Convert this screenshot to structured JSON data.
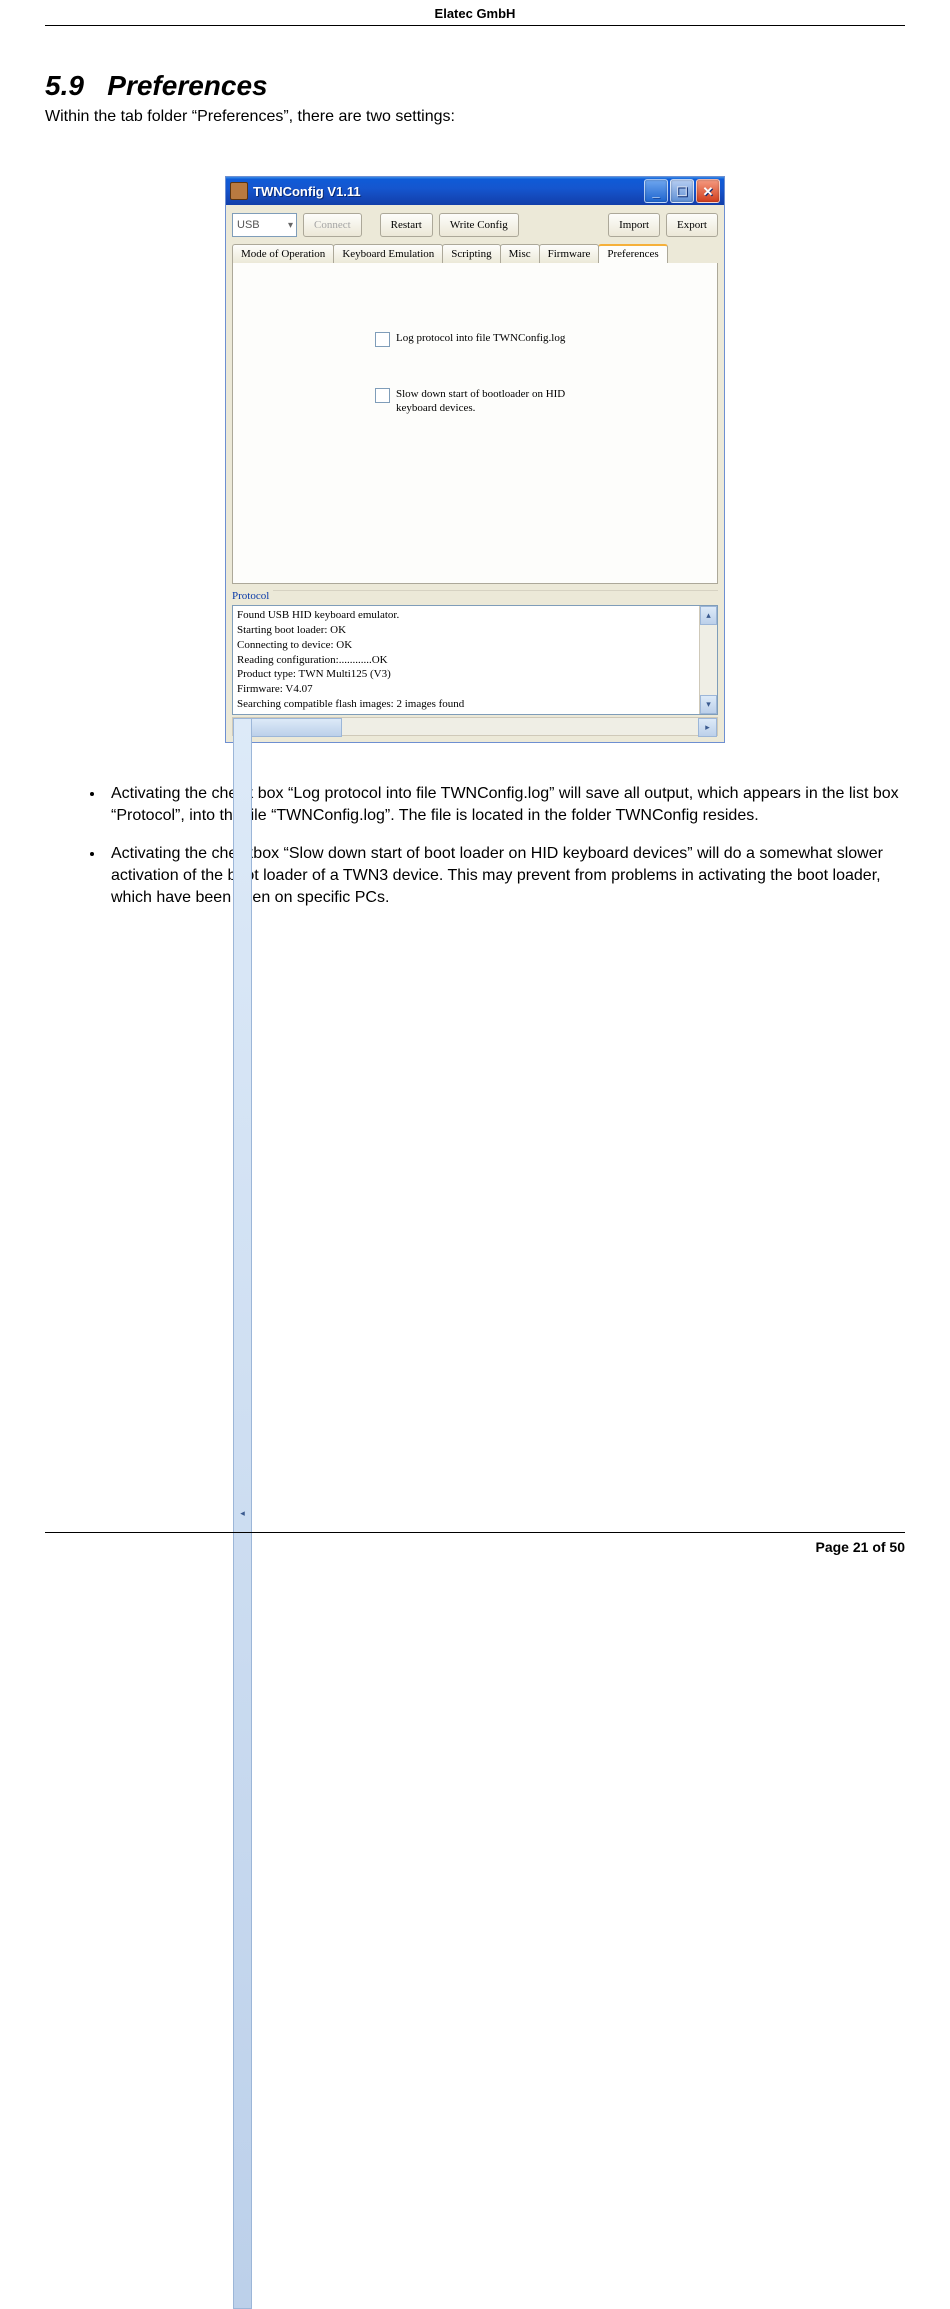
{
  "header_company": "Elatec GmbH",
  "section_number": "5.9",
  "section_name": "Preferences",
  "intro_text": "Within the tab folder “Preferences”, there are two settings:",
  "dialog": {
    "title": "TWNConfig V1.11",
    "usb_label": "USB",
    "buttons": {
      "connect": "Connect",
      "restart": "Restart",
      "write_config": "Write Config",
      "import": "Import",
      "export": "Export"
    },
    "tabs": [
      "Mode of Operation",
      "Keyboard Emulation",
      "Scripting",
      "Misc",
      "Firmware",
      "Preferences"
    ],
    "active_tab": "Preferences",
    "checkbox1": "Log protocol into file TWNConfig.log",
    "checkbox2": "Slow down start of bootloader on HID keyboard devices.",
    "protocol_label": "Protocol",
    "protocol_lines": [
      "Found USB HID keyboard emulator.",
      "Starting boot loader: OK",
      "Connecting to device: OK",
      "Reading configuration:............OK",
      "Product type: TWN Multi125 (V3)",
      "Firmware: V4.07",
      "Searching compatible flash images: 2 images found"
    ]
  },
  "bullets": [
    "Activating the check box “Log protocol into file TWNConfig.log” will save all output, which appears in the list box “Protocol”, into the file “TWNConfig.log”. The file is located in the folder TWNConfig resides.",
    "Activating the checkbox “Slow down start of boot loader on HID keyboard devices” will do a somewhat slower activation of the boot loader of a TWN3 device. This may prevent from problems in activating the boot loader, which have been seen on specific PCs."
  ],
  "footer": "Page 21 of 50"
}
